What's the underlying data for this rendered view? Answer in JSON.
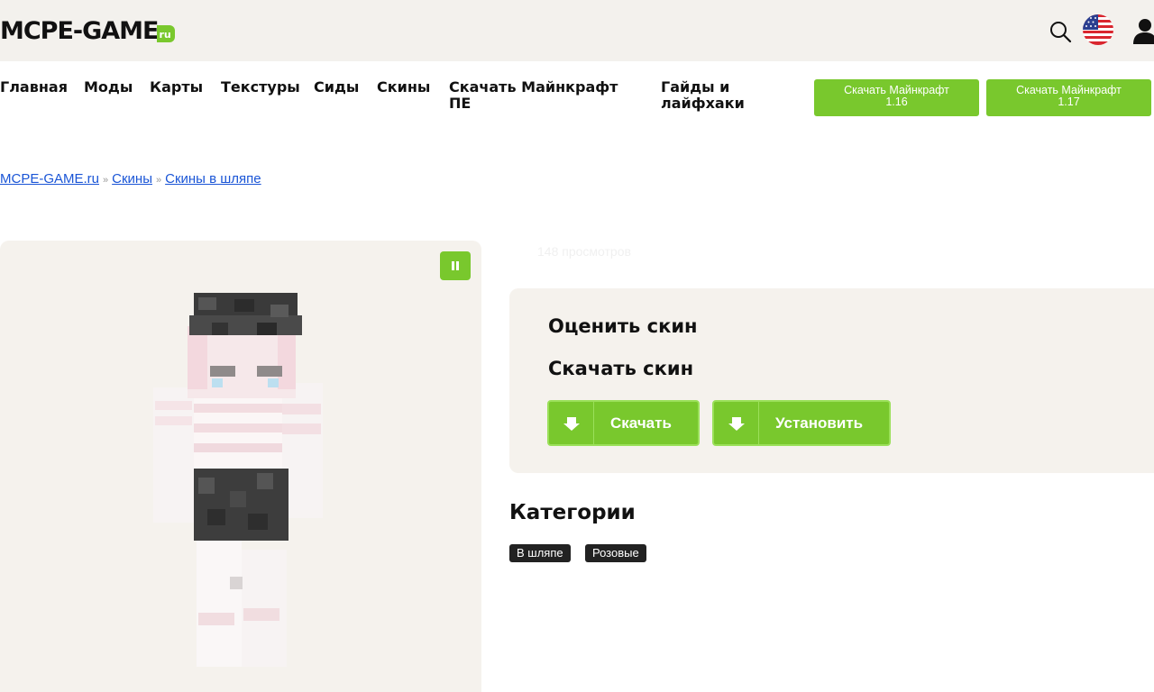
{
  "header": {
    "logo_main": "MCPE-GAME",
    "logo_suffix": "ru",
    "icons": [
      "search-icon",
      "us-flag-icon",
      "user-icon"
    ]
  },
  "nav": {
    "items": [
      "Главная",
      "Моды",
      "Карты",
      "Текстуры",
      "Сиды",
      "Скины"
    ],
    "download_pe_line1": "Скачать Майнкрафт",
    "download_pe_line2": "ПЕ",
    "guides_line1": "Гайды и",
    "guides_line2": "лайфхаки",
    "buttons": [
      {
        "line1": "Скачать Майнкрафт",
        "line2": "1.16"
      },
      {
        "line1": "Скачать Майнкрафт",
        "line2": "1.17"
      }
    ]
  },
  "breadcrumb": {
    "items": [
      "MCPE-GAME.ru",
      "Скины",
      "Скины в шляпе"
    ],
    "separator": "»"
  },
  "skin": {
    "views": "148 просмотров"
  },
  "panel": {
    "rate_title": "Оценить скин",
    "download_title": "Скачать скин",
    "download_button": "Скачать",
    "install_button": "Установить"
  },
  "categories": {
    "title": "Категории",
    "tags": [
      "В шляпе",
      "Розовые"
    ]
  },
  "colors": {
    "accent": "#79c82d",
    "header_bg": "#f3f1ed",
    "panel_bg": "#f5f2ed",
    "link": "#1a55d6"
  }
}
